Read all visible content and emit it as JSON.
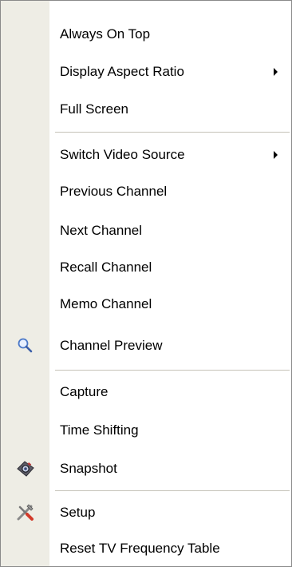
{
  "menu": {
    "items": [
      {
        "label": "Always On Top"
      },
      {
        "label": "Display Aspect Ratio",
        "submenu": true
      },
      {
        "label": "Full Screen"
      },
      {
        "label": "Switch Video Source",
        "submenu": true
      },
      {
        "label": "Previous Channel"
      },
      {
        "label": "Next Channel"
      },
      {
        "label": "Recall Channel"
      },
      {
        "label": "Memo Channel"
      },
      {
        "label": "Channel Preview",
        "icon": "magnifier-icon"
      },
      {
        "label": "Capture"
      },
      {
        "label": "Time Shifting"
      },
      {
        "label": "Snapshot",
        "icon": "camera-icon"
      },
      {
        "label": "Setup",
        "icon": "tools-icon"
      },
      {
        "label": "Reset TV Frequency Table"
      }
    ]
  },
  "colors": {
    "gutter": "#eeede5",
    "separator": "#c5c2b8",
    "border": "#8a8a8a"
  }
}
